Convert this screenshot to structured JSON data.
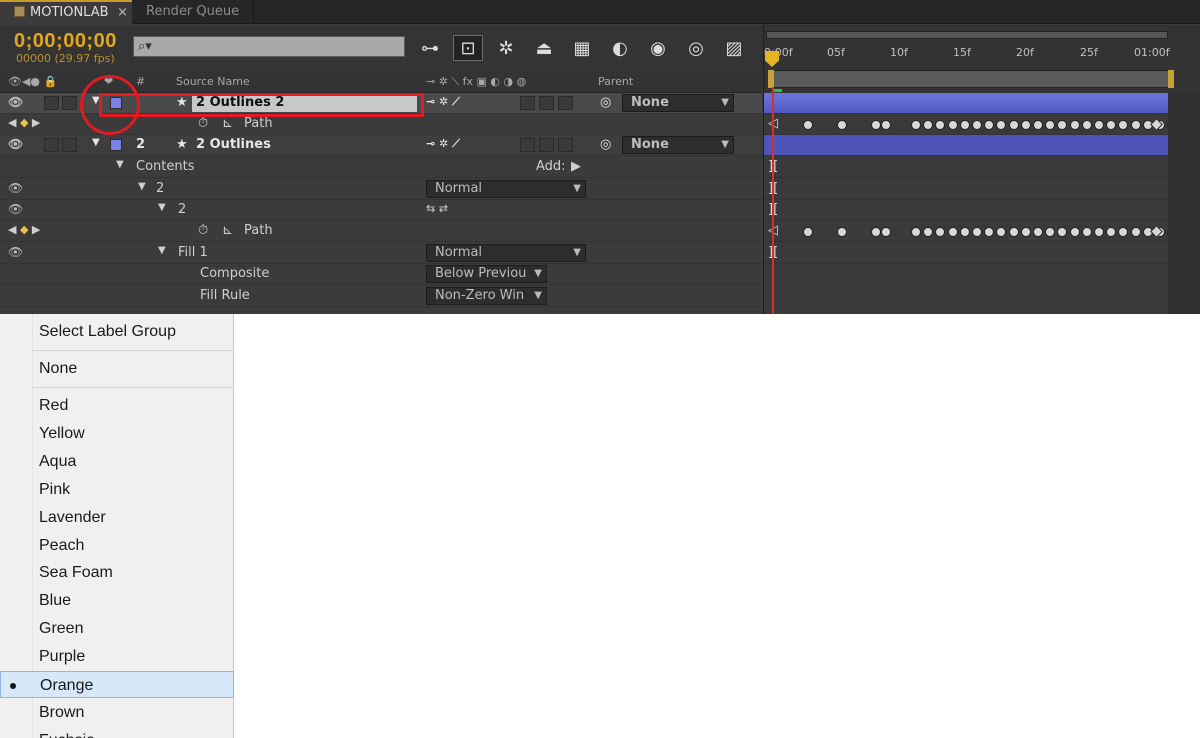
{
  "tabs": {
    "comp_label": "MOTIONLAB",
    "close_glyph": "×",
    "render_queue": "Render Queue"
  },
  "toolbar": {
    "timecode": "0;00;00;00",
    "fps": "00000 (29.97 fps)",
    "search_icon_glyph": "⌕▾"
  },
  "columns": {
    "source_name": "Source Name",
    "number": "#",
    "parent": "Parent"
  },
  "layers": [
    {
      "number": "",
      "name": "2 Outlines 2",
      "parent": "None"
    },
    {
      "number": "2",
      "name": "2 Outlines",
      "parent": "None"
    }
  ],
  "properties": {
    "path": "Path",
    "contents": "Contents",
    "add": "Add:",
    "group": "2",
    "subgroup": "2",
    "path2": "Path",
    "fill": "Fill 1",
    "composite": "Composite",
    "fill_rule": "Fill Rule"
  },
  "blend": {
    "group_mode": "Normal",
    "fill_mode": "Normal",
    "composite_value": "Below Previou",
    "fill_rule_value": "Non-Zero Win"
  },
  "ruler": {
    "ticks": [
      "0:00f",
      "05f",
      "10f",
      "15f",
      "20f",
      "25f",
      "01:00f"
    ]
  },
  "menu": {
    "header": "Select Label Group",
    "none": "None",
    "items": [
      "Red",
      "Yellow",
      "Aqua",
      "Pink",
      "Lavender",
      "Peach",
      "Sea Foam",
      "Blue",
      "Green",
      "Purple",
      "Orange",
      "Brown",
      "Fuchsia"
    ],
    "selected": "Orange"
  },
  "colors": {
    "timecode": "#e1a722",
    "label_lavender": "#7b82e6",
    "annotation_red": "#e21b22",
    "menu_highlight": "#d7e8f8"
  }
}
